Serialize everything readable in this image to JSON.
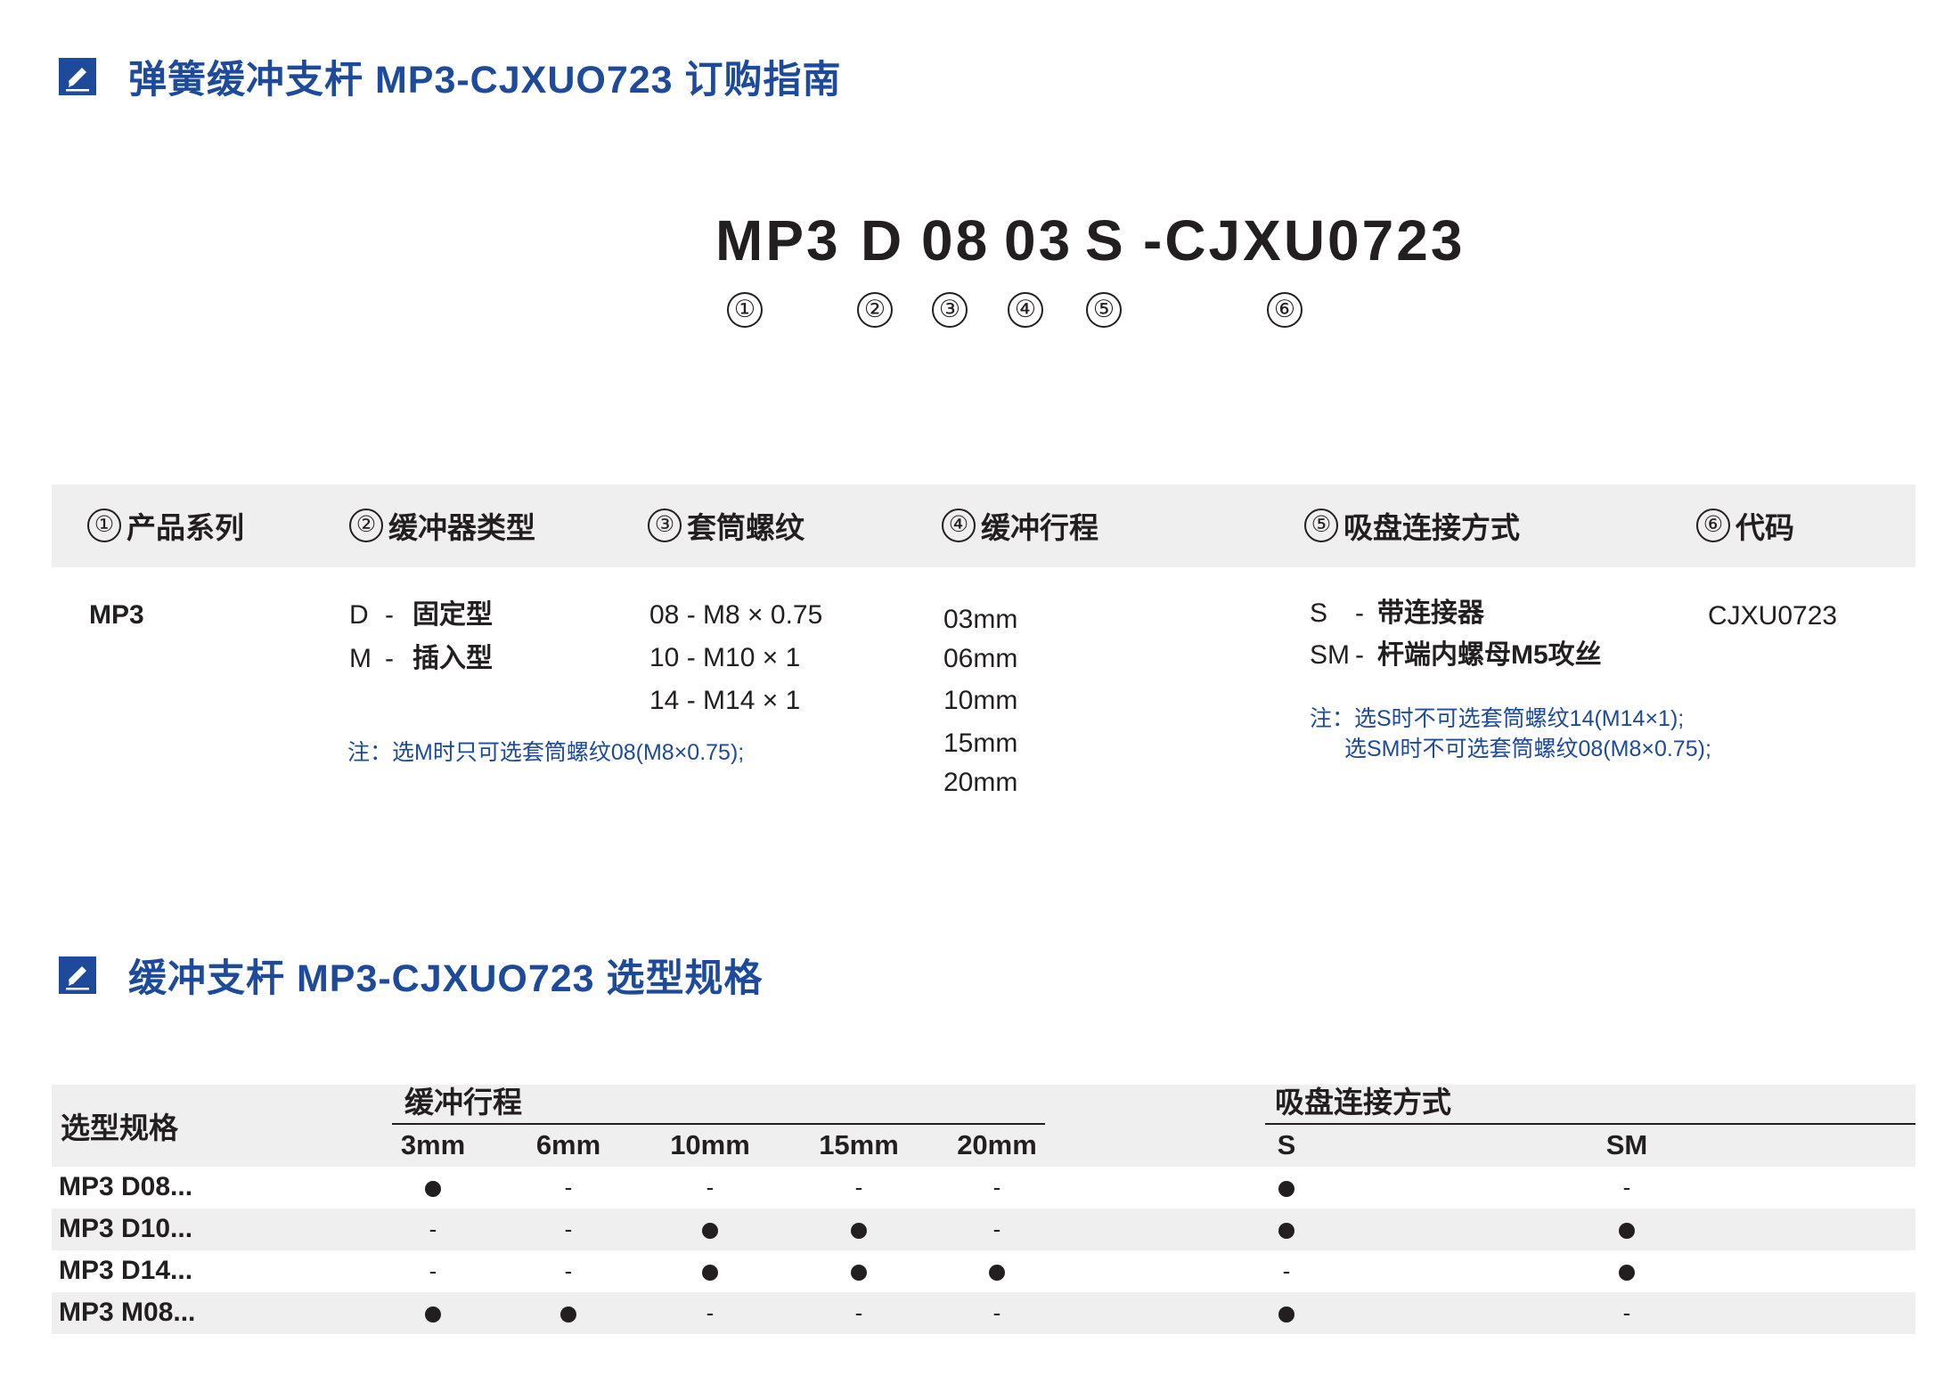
{
  "section1": {
    "title": "弹簧缓冲支杆 MP3-CJXUO723 订购指南",
    "icon": "pen-edit-icon"
  },
  "model_code": {
    "parts": [
      "MP3",
      "D",
      "08",
      "03",
      "S",
      "-CJXU0723"
    ],
    "numbers": [
      "①",
      "②",
      "③",
      "④",
      "⑤",
      "⑥"
    ]
  },
  "order_table": {
    "headers": [
      {
        "num": "①",
        "label": "产品系列"
      },
      {
        "num": "②",
        "label": "缓冲器类型"
      },
      {
        "num": "③",
        "label": "套筒螺纹"
      },
      {
        "num": "④",
        "label": "缓冲行程"
      },
      {
        "num": "⑤",
        "label": "吸盘连接方式"
      },
      {
        "num": "⑥",
        "label": "代码"
      }
    ],
    "series": [
      "MP3"
    ],
    "types": [
      {
        "code": "D",
        "dash": "-",
        "name": "固定型"
      },
      {
        "code": "M",
        "dash": "-",
        "name": "插入型"
      }
    ],
    "type_note": "注：选M时只可选套筒螺纹08(M8×0.75);",
    "threads": [
      "08 - M8 × 0.75",
      "10 - M10 × 1",
      "14 - M14 × 1"
    ],
    "strokes": [
      "03mm",
      "06mm",
      "10mm",
      "15mm",
      "20mm"
    ],
    "connections": [
      {
        "code": "S",
        "dash": "-",
        "name": "带连接器"
      },
      {
        "code": "SM",
        "dash": "-",
        "name": "杆端内螺母M5攻丝"
      }
    ],
    "connection_note": [
      "注：选S时不可选套筒螺纹14(M14×1);",
      "选SM时不可选套筒螺纹08(M8×0.75);"
    ],
    "code": "CJXU0723"
  },
  "section2": {
    "title": "缓冲支杆 MP3-CJXUO723  选型规格",
    "icon": "pen-edit-icon"
  },
  "spec_table": {
    "row_header": "选型规格",
    "group1": "缓冲行程",
    "group2": "吸盘连接方式",
    "stroke_cols": [
      "3mm",
      "6mm",
      "10mm",
      "15mm",
      "20mm"
    ],
    "conn_cols": [
      "S",
      "SM"
    ],
    "rows": [
      {
        "label": "MP3 D08...",
        "stroke": [
          1,
          0,
          0,
          0,
          0
        ],
        "conn": [
          1,
          0
        ]
      },
      {
        "label": "MP3 D10...",
        "stroke": [
          0,
          0,
          1,
          1,
          0
        ],
        "conn": [
          1,
          1
        ]
      },
      {
        "label": "MP3 D14...",
        "stroke": [
          0,
          0,
          1,
          1,
          1
        ],
        "conn": [
          0,
          1
        ]
      },
      {
        "label": "MP3 M08...",
        "stroke": [
          1,
          1,
          0,
          0,
          0
        ],
        "conn": [
          1,
          0
        ]
      }
    ],
    "dash": "-"
  },
  "colors": {
    "accent": "#1d4a9a",
    "text": "#231f20",
    "band": "#efefef"
  }
}
